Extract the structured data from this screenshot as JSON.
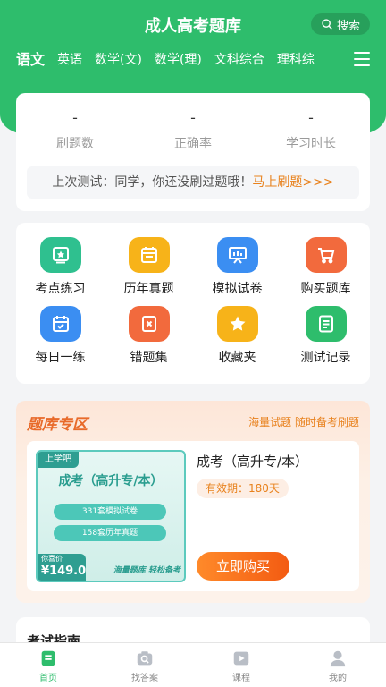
{
  "header": {
    "title": "成人高考题库",
    "search_label": "搜索"
  },
  "tabs": [
    "语文",
    "英语",
    "数学(文)",
    "数学(理)",
    "文科综合",
    "理科综"
  ],
  "stats": [
    {
      "value": "-",
      "label": "刷题数"
    },
    {
      "value": "-",
      "label": "正确率"
    },
    {
      "value": "-",
      "label": "学习时长"
    }
  ],
  "last_test": {
    "text": "上次测试：同学，你还没刷过题哦！",
    "link": "马上刷题>>>"
  },
  "grid": [
    {
      "label": "考点练习",
      "color": "#2fc08f",
      "icon": "star-box-icon"
    },
    {
      "label": "历年真题",
      "color": "#f7b319",
      "icon": "calendar-icon"
    },
    {
      "label": "模拟试卷",
      "color": "#3b8ef2",
      "icon": "easel-icon"
    },
    {
      "label": "购买题库",
      "color": "#f26a3d",
      "icon": "cart-icon"
    },
    {
      "label": "每日一练",
      "color": "#3b8ef2",
      "icon": "calendar-check-icon"
    },
    {
      "label": "错题集",
      "color": "#f26a3d",
      "icon": "error-box-icon"
    },
    {
      "label": "收藏夹",
      "color": "#f7b319",
      "icon": "star-icon"
    },
    {
      "label": "测试记录",
      "color": "#2ebd6c",
      "icon": "document-icon"
    }
  ],
  "zone": {
    "title": "题库专区",
    "slogan": "海量试题  随时备考刷题",
    "product": {
      "cover_brand": "上学吧",
      "cover_title": "成考（高升专/本）",
      "cover_pill_1": "331套模拟试卷",
      "cover_pill_2": "158套历年真题",
      "cover_price_label": "你喜价",
      "cover_price": "¥149.0",
      "cover_slogan": "海量题库  轻松备考",
      "name": "成考（高升专/本）",
      "validity": "有效期：180天",
      "buy_label": "立即购买"
    }
  },
  "guide": {
    "title": "考试指南"
  },
  "bottom_nav": [
    {
      "label": "首页",
      "icon": "home-icon",
      "active": true
    },
    {
      "label": "找答案",
      "icon": "camera-search-icon",
      "active": false
    },
    {
      "label": "课程",
      "icon": "video-icon",
      "active": false
    },
    {
      "label": "我的",
      "icon": "user-icon",
      "active": false
    }
  ],
  "colors": {
    "brand": "#2ebd6c",
    "accent": "#e8811c"
  }
}
